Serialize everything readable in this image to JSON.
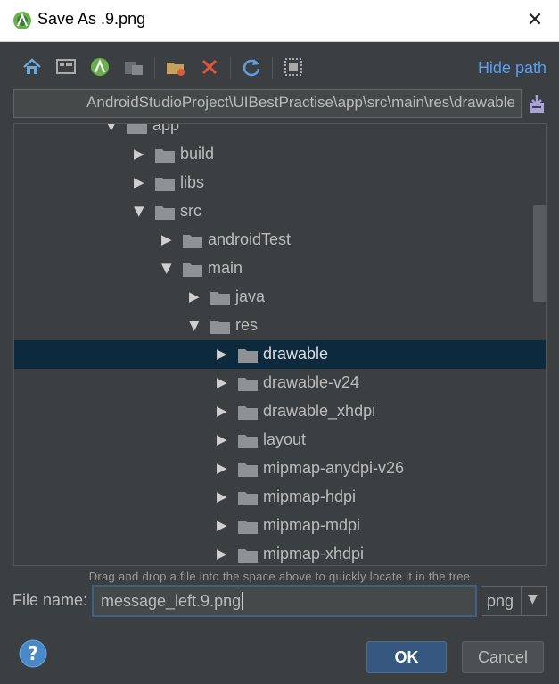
{
  "window": {
    "title": "Save As .9.png",
    "app_icon": "android-studio-icon",
    "close_icon": "close-icon"
  },
  "toolbar": {
    "buttons": [
      "home-icon",
      "desktop-icon",
      "android-project-icon",
      "module-icon",
      "new-folder-icon",
      "delete-icon",
      "refresh-icon",
      "show-hidden-icon"
    ],
    "hide_path_label": "Hide path"
  },
  "path": {
    "value": "AndroidStudioProject\\UIBestPractise\\app\\src\\main\\res\\drawable"
  },
  "tree": {
    "items": [
      {
        "label": "app",
        "expanded": true,
        "depth": 0
      },
      {
        "label": "build",
        "expanded": false,
        "depth": 1
      },
      {
        "label": "libs",
        "expanded": false,
        "depth": 1
      },
      {
        "label": "src",
        "expanded": true,
        "depth": 1
      },
      {
        "label": "androidTest",
        "expanded": false,
        "depth": 2
      },
      {
        "label": "main",
        "expanded": true,
        "depth": 2
      },
      {
        "label": "java",
        "expanded": false,
        "depth": 3
      },
      {
        "label": "res",
        "expanded": true,
        "depth": 3
      },
      {
        "label": "drawable",
        "expanded": false,
        "depth": 4,
        "selected": true
      },
      {
        "label": "drawable-v24",
        "expanded": false,
        "depth": 4
      },
      {
        "label": "drawable_xhdpi",
        "expanded": false,
        "depth": 4
      },
      {
        "label": "layout",
        "expanded": false,
        "depth": 4
      },
      {
        "label": "mipmap-anydpi-v26",
        "expanded": false,
        "depth": 4
      },
      {
        "label": "mipmap-hdpi",
        "expanded": false,
        "depth": 4
      },
      {
        "label": "mipmap-mdpi",
        "expanded": false,
        "depth": 4
      },
      {
        "label": "mipmap-xhdpi",
        "expanded": false,
        "depth": 4
      }
    ]
  },
  "hint": "Drag and drop a file into the space above to quickly locate it in the tree",
  "file_name": {
    "label": "File name:",
    "value": "message_left.9.png"
  },
  "extension": {
    "selected": "png"
  },
  "buttons": {
    "ok": "OK",
    "cancel": "Cancel",
    "help_icon": "help-icon"
  },
  "colors": {
    "selection": "#0d293e",
    "link": "#589df6",
    "ok_button": "#365880",
    "background": "#3c3f41"
  }
}
